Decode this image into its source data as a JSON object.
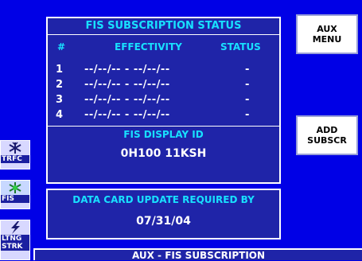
{
  "status_panel": {
    "title": "FIS SUBSCRIPTION STATUS",
    "col_num": "#",
    "col_effectivity": "EFFECTIVITY",
    "col_status": "STATUS",
    "rows": [
      {
        "num": "1",
        "effectivity": "--/--/-- - --/--/--",
        "status": "-"
      },
      {
        "num": "2",
        "effectivity": "--/--/-- - --/--/--",
        "status": "-"
      },
      {
        "num": "3",
        "effectivity": "--/--/-- - --/--/--",
        "status": "-"
      },
      {
        "num": "4",
        "effectivity": "--/--/-- - --/--/--",
        "status": "-"
      }
    ],
    "display_id_label": "FIS DISPLAY ID",
    "display_id_value": "0H100 11KSH"
  },
  "data_card": {
    "label": "DATA CARD UPDATE REQUIRED BY",
    "date": "07/31/04"
  },
  "buttons": {
    "aux_menu_line1": "AUX",
    "aux_menu_line2": "MENU",
    "add_subscr_line1": "ADD",
    "add_subscr_line2": "SUBSCR"
  },
  "left_buttons": {
    "trfc": "TRFC",
    "fis": "FIS",
    "ltng": "LTNG",
    "strk": "STRK"
  },
  "footer": {
    "title": "AUX - FIS SUBSCRIPTION"
  },
  "colors": {
    "background": "#0000e6",
    "panel": "#1f24a8",
    "header_text": "#18e0ff",
    "value_text": "#ffffff"
  }
}
